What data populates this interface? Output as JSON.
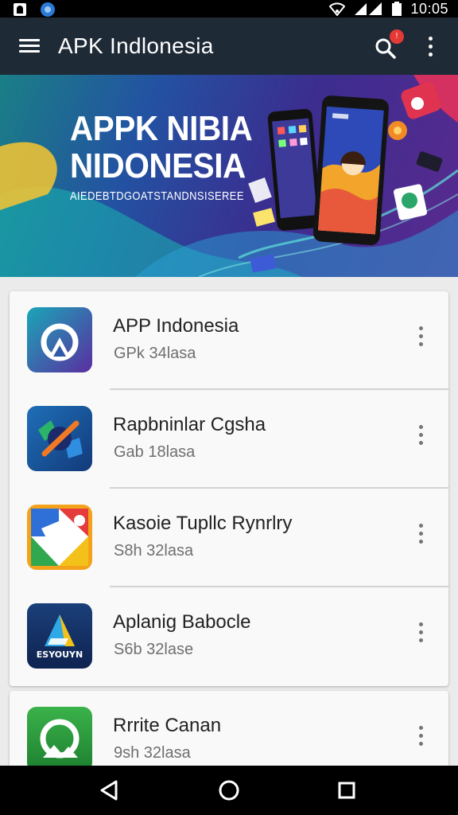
{
  "status_bar": {
    "time": "10:05",
    "icons": [
      "ghost-icon",
      "globe-icon",
      "wifi-icon",
      "signal-icon",
      "battery-icon"
    ]
  },
  "app_bar": {
    "title": "APK Indlonesia",
    "icons": [
      "menu-icon",
      "search-icon",
      "more-vert-icon"
    ],
    "notification_badge": "!"
  },
  "banner": {
    "title_line1": "APPK NIBIA",
    "title_line2": "NIDONESIA",
    "subtitle": "AIEDEBTDGOATSTANDNSISEREE"
  },
  "apps": [
    {
      "name": "APP Indonesia",
      "subtitle": "GPk 34lasa",
      "icon": "app-indonesia-icon"
    },
    {
      "name": "Rapbninlar Cgsha",
      "subtitle": "Gab 18lasa",
      "icon": "rapbninlar-icon"
    },
    {
      "name": "Kasoie Tupllc Rynrlry",
      "subtitle": "S8h 32lasa",
      "icon": "kasoie-icon"
    },
    {
      "name": "Aplanig Babocle",
      "subtitle": "S6b 32lase",
      "icon_text": "ESYOUYN",
      "icon": "aplanig-icon"
    },
    {
      "name": "Rrrite Canan",
      "subtitle": "9sh 32lasa",
      "icon": "rrrite-icon"
    }
  ],
  "colors": {
    "app_bar": "#1f2a37",
    "background": "#ebebeb",
    "card": "#f9f9f9",
    "badge": "#e53935"
  },
  "nav_bar": {
    "icons": [
      "back-icon",
      "home-icon",
      "recents-icon"
    ]
  }
}
